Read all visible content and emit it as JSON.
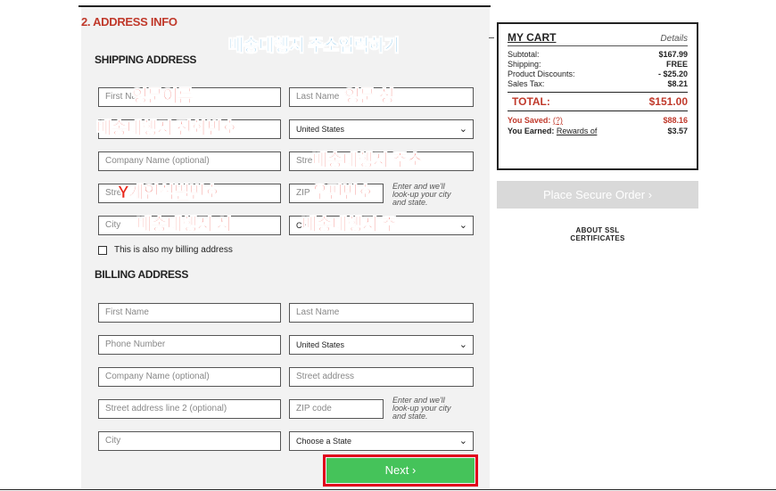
{
  "section_title": "2. ADDRESS INFO",
  "shipping": {
    "title": "SHIPPING ADDRESS",
    "first_name": "First Na",
    "last_name": "Last Name",
    "country": "United States",
    "company": "Company Name (optional)",
    "street": "Stre",
    "street2": "Stre",
    "zip": "ZIP",
    "zip_hint": "Enter and we'll look-up your city and state.",
    "city": "City",
    "state": "Ch"
  },
  "billing_checkbox_label": "This is also my billing address",
  "billing": {
    "title": "BILLING ADDRESS",
    "first_name": "First Name",
    "last_name": "Last Name",
    "phone": "Phone Number",
    "country": "United States",
    "company": "Company Name (optional)",
    "street": "Street address",
    "street2": "Street address line 2 (optional)",
    "zip": "ZIP code",
    "zip_hint": "Enter and we'll look-up your city and state.",
    "city": "City",
    "state": "Choose a State"
  },
  "next_label": "Next ›",
  "annotations": {
    "header": "배송대행지 주소입력하기",
    "first_name": "영문이름",
    "last_name": "영문 성",
    "phone": "배송대행지 전화번호",
    "street": "배송대행지 주소",
    "personal_id": "Y개인식별번호",
    "zip": "우편번호",
    "city": "배송대행지 시",
    "state": "배송대행지 주"
  },
  "cart": {
    "title": "MY CART",
    "details": "Details",
    "rows": [
      {
        "label": "Subtotal:",
        "value": "$167.99"
      },
      {
        "label": "Shipping:",
        "value": "FREE"
      },
      {
        "label": "Product Discounts:",
        "value": "- $25.20"
      },
      {
        "label": "Sales Tax:",
        "value": "$8.21"
      }
    ],
    "total_label": "TOTAL:",
    "total_value": "$151.00",
    "saved_label": "You Saved:",
    "saved_link": "(?)",
    "saved_value": "$88.16",
    "earned_label": "You Earned:",
    "earned_link": "Rewards of",
    "earned_value": "$3.57"
  },
  "place_order": "Place Secure Order  ›",
  "ssl_line1": "ABOUT SSL",
  "ssl_line2": "CERTIFICATES",
  "colors": {
    "accent_red": "#c0392b",
    "next_green": "#45c35a",
    "annotation_red": "#e8261a",
    "annotation_blue": "#1a8fd6",
    "disabled_gray": "#d9d9d9"
  }
}
